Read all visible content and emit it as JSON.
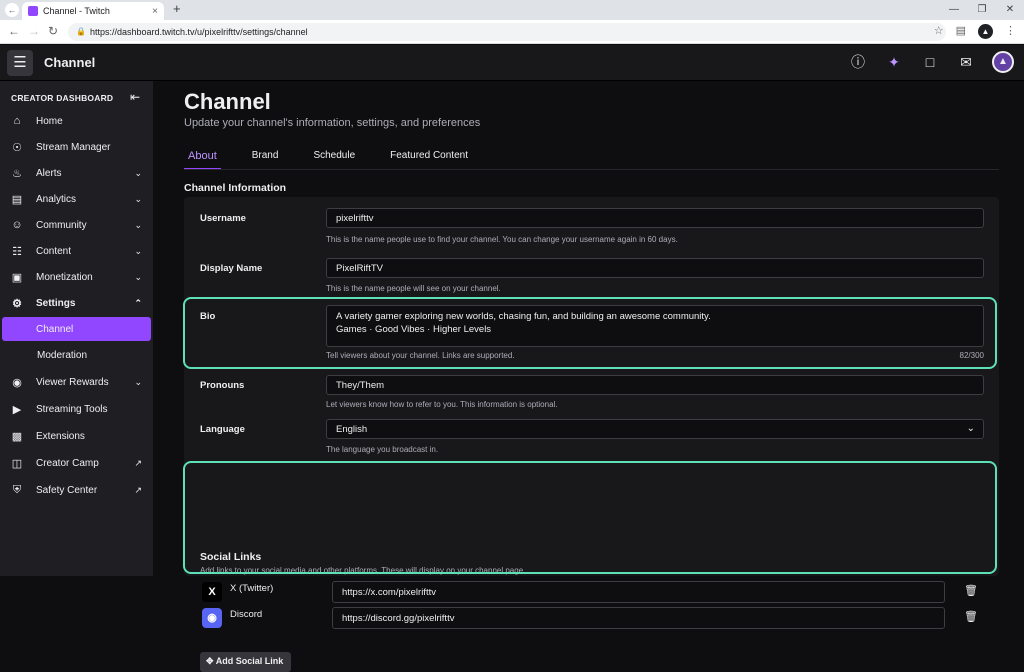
{
  "browser": {
    "tab_title": "Channel - Twitch",
    "url": "https://dashboard.twitch.tv/u/pixelrifttv/settings/channel"
  },
  "topbar": {
    "title": "Channel"
  },
  "sidebar": {
    "header": "CREATOR DASHBOARD",
    "items": [
      {
        "label": "Home",
        "icon": "home-icon"
      },
      {
        "label": "Stream Manager",
        "icon": "broadcast-icon"
      },
      {
        "label": "Alerts",
        "icon": "bell-icon"
      },
      {
        "label": "Analytics",
        "icon": "chart-icon"
      },
      {
        "label": "Community",
        "icon": "community-icon"
      },
      {
        "label": "Content",
        "icon": "content-icon"
      },
      {
        "label": "Monetization",
        "icon": "monetization-icon"
      },
      {
        "label": "Settings",
        "icon": "gear-icon"
      },
      {
        "label": "Channel"
      },
      {
        "label": "Moderation"
      },
      {
        "label": "Viewer Rewards",
        "icon": "rewards-icon"
      },
      {
        "label": "Streaming Tools",
        "icon": "video-icon"
      },
      {
        "label": "Extensions",
        "icon": "puzzle-icon"
      },
      {
        "label": "Creator Camp",
        "icon": "book-icon"
      },
      {
        "label": "Safety Center",
        "icon": "shield-icon"
      }
    ]
  },
  "page": {
    "title": "Channel",
    "subtitle": "Update your channel's information, settings, and preferences",
    "tabs": [
      "About",
      "Brand",
      "Schedule",
      "Featured Content"
    ],
    "section_title": "Channel Information"
  },
  "form": {
    "username": {
      "label": "Username",
      "value": "pixelrifttv",
      "help": "This is the name people use to find your channel. You can change your username again in 60 days."
    },
    "display_name": {
      "label": "Display Name",
      "value": "PixelRiftTV",
      "help": "This is the name people will see on your channel."
    },
    "bio": {
      "label": "Bio",
      "line1": "A variety gamer exploring new worlds, chasing fun, and building an awesome community.",
      "line2": "Games · Good Vibes · Higher Levels",
      "help": "Tell viewers about your channel. Links are supported.",
      "counter": "82/300"
    },
    "pronouns": {
      "label": "Pronouns",
      "value": "They/Them",
      "help": "Let viewers know how to refer to you. This information is optional."
    },
    "language": {
      "label": "Language",
      "value": "English",
      "help": "The language you broadcast in."
    }
  },
  "social": {
    "title": "Social Links",
    "subtitle": "Add links to your social media and other platforms. These will display on your channel page.",
    "links": [
      {
        "name": "X (Twitter)",
        "url": "https://x.com/pixelrifttv",
        "icon": "x-icon"
      },
      {
        "name": "Discord",
        "url": "https://discord.gg/pixelrifttv",
        "icon": "discord-icon"
      }
    ],
    "add_label": "Add Social Link"
  },
  "colors": {
    "accent": "#9146ff",
    "highlight": "#5ee0b7"
  }
}
